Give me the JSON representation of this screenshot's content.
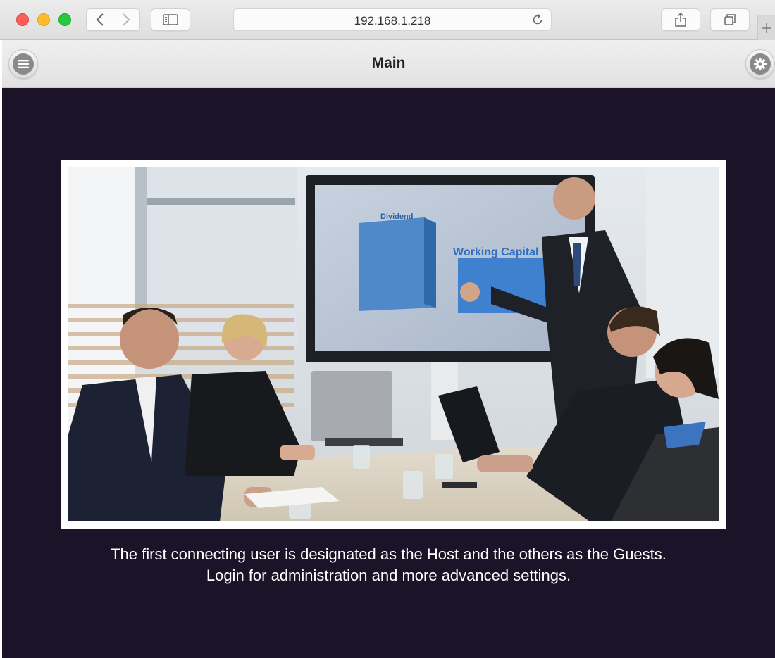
{
  "browser": {
    "url": "192.168.1.218",
    "icons": [
      "back-icon",
      "forward-icon",
      "sidebar-icon",
      "reload-icon",
      "share-icon",
      "tabs-icon",
      "plus-icon"
    ]
  },
  "header": {
    "title": "Main",
    "left_icon": "menu-icon",
    "right_icon": "gear-icon"
  },
  "main": {
    "background": "#1b1428",
    "image_description_icon": "hero-image",
    "line1": "The first connecting user is designated as the Host and the others as the Guests.",
    "line2": "Login for administration and more advanced settings."
  },
  "hero": {
    "screen_text_top": "Dividend",
    "screen_text_main": "Working Capital"
  }
}
